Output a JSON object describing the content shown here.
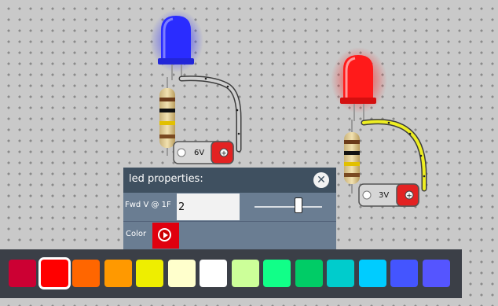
{
  "dialog": {
    "title": "led properties:",
    "close_label": "✕",
    "fwd_label": "Fwd V @ 1F",
    "fwd_value": "2",
    "color_label": "Color"
  },
  "batteries": [
    {
      "label": "6V"
    },
    {
      "label": "3V"
    }
  ],
  "palette": {
    "selected_index": 1,
    "swatches": [
      "#cc0033",
      "#ff0000",
      "#ff6600",
      "#ff9900",
      "#eeee00",
      "#ffffcc",
      "#ffffff",
      "#ccff99",
      "#11ff88",
      "#00cc66",
      "#00cccc",
      "#00ccff",
      "#4455ff",
      "#5555ff"
    ]
  },
  "colors": {
    "blue_led": "#2a2cff",
    "red_led": "#ff1a1a",
    "battery_grey": "#d6d6d6",
    "battery_red": "#e32222",
    "wire_grey": "#d0d0d0",
    "wire_yellow": "#eeee22",
    "dialog_bg": "#6a7d92",
    "dialog_title_bg": "#3f5060",
    "palette_bg": "#3b3f47"
  },
  "icons": [
    "close-icon",
    "play-icon",
    "battery-polarity-icon"
  ]
}
